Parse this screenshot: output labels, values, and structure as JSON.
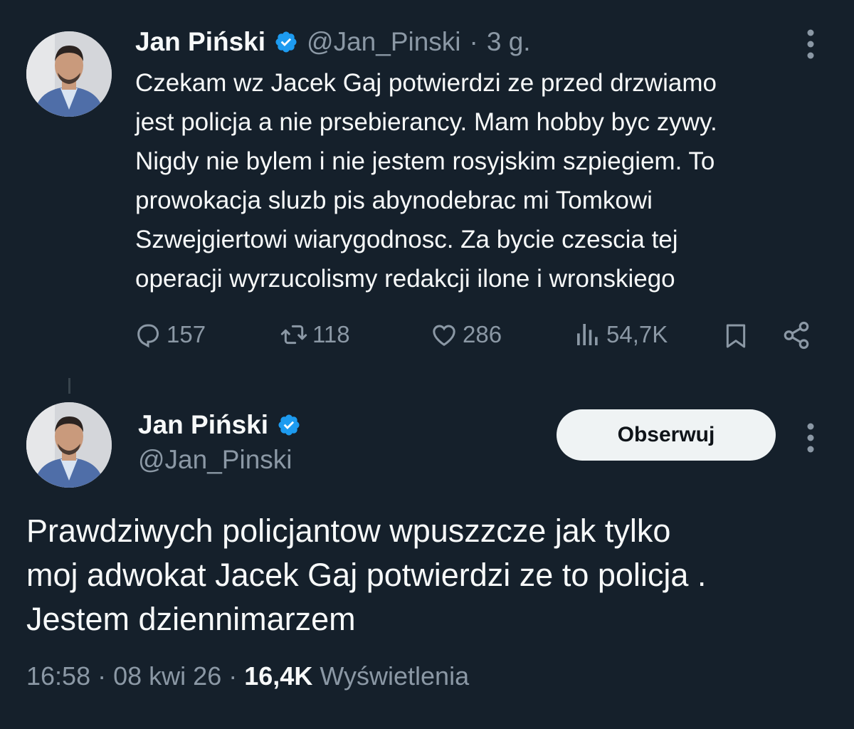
{
  "tweet1": {
    "author_name": "Jan Piński",
    "handle": "@Jan_Pinski",
    "separator": "·",
    "time": "3 g.",
    "lines": [
      "Czekam wz Jacek Gaj potwierdzi ze przed drzwiamo",
      "jest policja a nie prsebierancy. Mam hobby byc zywy.",
      "Nigdy nie bylem i nie jestem rosyjskim szpiegiem. To",
      "prowokacja sluzb pis abynodebrac mi Tomkowi",
      "Szwejgiertowi wiarygodnosc. Za bycie czescia tej",
      "operacji wyrzucolismy redakcji  ilone i wronskiego"
    ],
    "actions": {
      "replies": "157",
      "retweets": "118",
      "likes": "286",
      "views": "54,7K"
    },
    "icons": [
      "verified-badge-icon",
      "more-icon",
      "reply-icon",
      "retweet-icon",
      "like-icon",
      "views-icon",
      "bookmark-icon",
      "share-icon"
    ]
  },
  "tweet2": {
    "author_name": "Jan Piński",
    "handle": "@Jan_Pinski",
    "follow_label": "Obserwuj",
    "lines": [
      "Prawdziwych policjantow wpuszzcze jak tylko",
      "moj adwokat Jacek Gaj potwierdzi ze to policja .",
      "Jestem dziennimarzem"
    ],
    "time": "16:58",
    "date": "08 kwi 26",
    "separator": "·",
    "views_count": "16,4K",
    "views_label": "Wyświetlenia"
  },
  "colors": {
    "background": "#15202b",
    "text": "#f7f9f9",
    "muted": "#8b98a5",
    "verified": "#1d9bf0",
    "button_bg": "#eff3f4"
  }
}
